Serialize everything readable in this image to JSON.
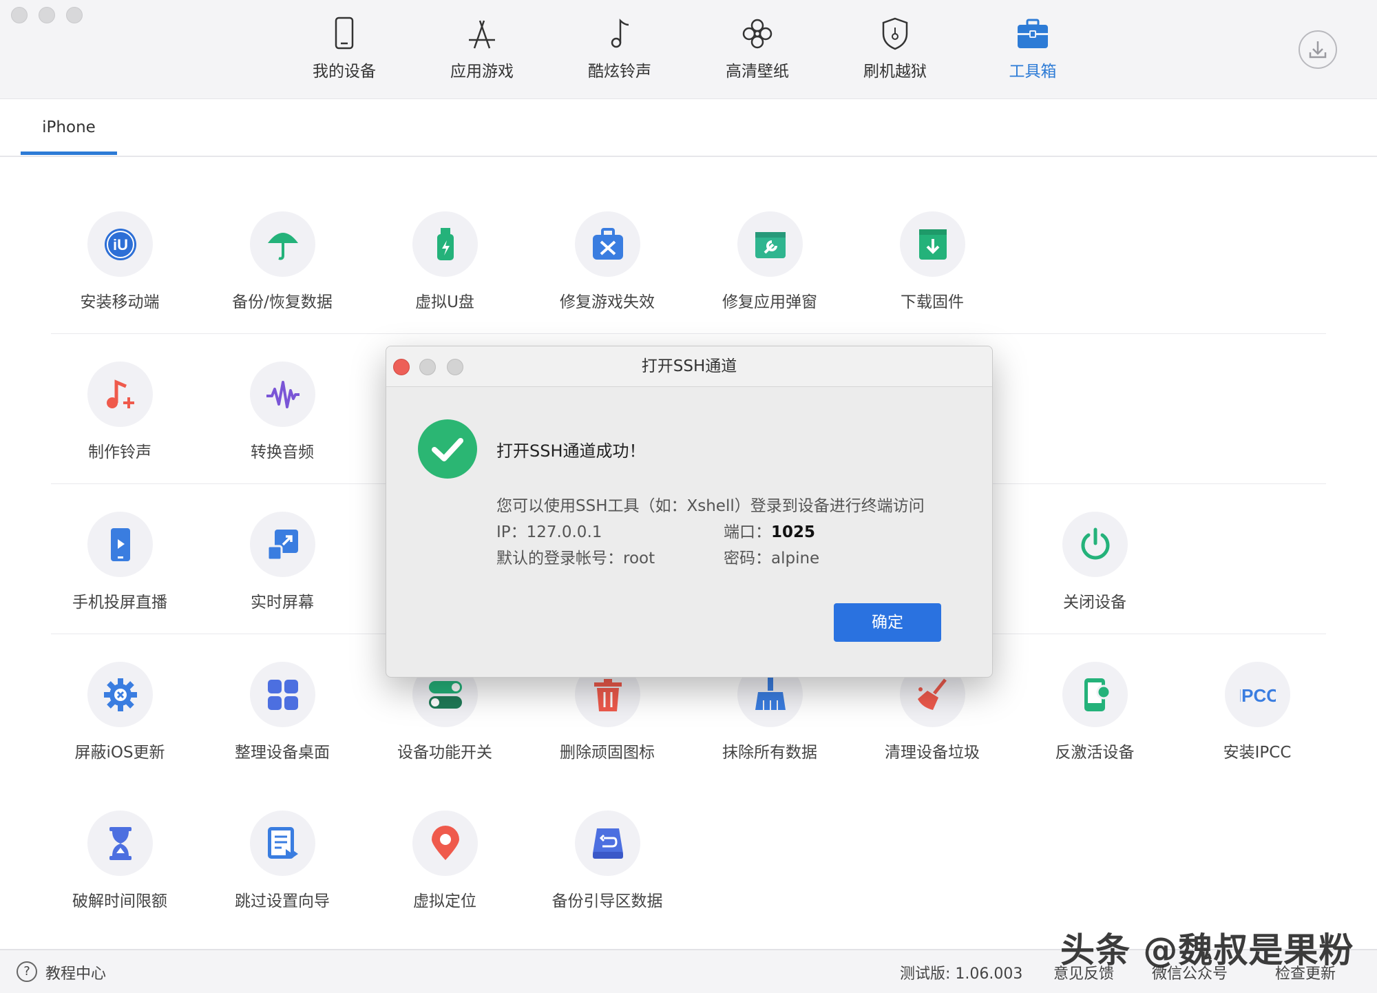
{
  "nav": {
    "items": [
      {
        "label": "我的设备",
        "icon": "phone-icon"
      },
      {
        "label": "应用游戏",
        "icon": "app-store-icon"
      },
      {
        "label": "酷炫铃声",
        "icon": "music-note-icon"
      },
      {
        "label": "高清壁纸",
        "icon": "flower-icon"
      },
      {
        "label": "刷机越狱",
        "icon": "shield-icon"
      },
      {
        "label": "工具箱",
        "icon": "toolbox-icon"
      }
    ],
    "active_index": 5,
    "active_color": "#2d7bd6"
  },
  "device_tab": {
    "label": "iPhone"
  },
  "tools": [
    {
      "label": "安装移动端",
      "icon": "iu-logo-icon"
    },
    {
      "label": "备份/恢复数据",
      "icon": "umbrella-icon"
    },
    {
      "label": "虚拟U盘",
      "icon": "usb-drive-icon"
    },
    {
      "label": "修复游戏失效",
      "icon": "repair-kit-icon"
    },
    {
      "label": "修复应用弹窗",
      "icon": "app-wrench-icon"
    },
    {
      "label": "下载固件",
      "icon": "download-box-icon"
    },
    {
      "label": "制作铃声",
      "icon": "music-plus-icon"
    },
    {
      "label": "转换音频",
      "icon": "audio-wave-icon"
    },
    {
      "label": "手机投屏直播",
      "icon": "phone-play-icon"
    },
    {
      "label": "实时屏幕",
      "icon": "screen-arrow-icon"
    },
    {
      "label": "关闭设备",
      "icon": "power-icon"
    },
    {
      "label": "屏蔽iOS更新",
      "icon": "gear-block-icon"
    },
    {
      "label": "整理设备桌面",
      "icon": "grid-icon"
    },
    {
      "label": "设备功能开关",
      "icon": "toggle-icon"
    },
    {
      "label": "删除顽固图标",
      "icon": "trash-icon"
    },
    {
      "label": "抹除所有数据",
      "icon": "broom-icon"
    },
    {
      "label": "清理设备垃圾",
      "icon": "sweep-icon"
    },
    {
      "label": "反激活设备",
      "icon": "phone-deactivate-icon"
    },
    {
      "label": "安装IPCC",
      "icon": "ipcc-icon",
      "text": "IPCC"
    },
    {
      "label": "破解时间限额",
      "icon": "hourglass-icon"
    },
    {
      "label": "跳过设置向导",
      "icon": "skip-wizard-icon"
    },
    {
      "label": "虚拟定位",
      "icon": "location-pin-icon"
    },
    {
      "label": "备份引导区数据",
      "icon": "drive-restore-icon"
    }
  ],
  "dialog": {
    "title": "打开SSH通道",
    "heading": "打开SSH通道成功！",
    "description": "您可以使用SSH工具（如：Xshell）登录到设备进行终端访问",
    "ip_label": "IP：",
    "ip_value": "127.0.0.1",
    "port_label": "端口：",
    "port_value": "1025",
    "account_label": "默认的登录帐号：",
    "account_value": "root",
    "password_label": "密码：",
    "password_value": "alpine",
    "confirm_label": "确定",
    "success_color": "#2bb673",
    "button_color": "#2a72e0"
  },
  "footer": {
    "help": "教程中心",
    "version": "测试版: 1.06.003",
    "feedback": "意见反馈",
    "wechat": "微信公众号",
    "update": "检查更新"
  },
  "watermark": "头条 @魏叔是果粉"
}
